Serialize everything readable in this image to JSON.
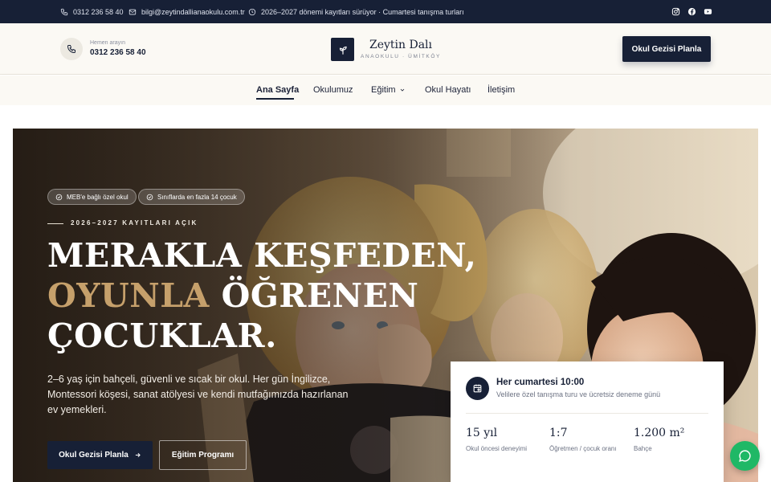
{
  "topbar": {
    "phone": "0312 236 58 40",
    "email": "bilgi@zeytindallianaokulu.com.tr",
    "notice": "2026–2027 dönemi kayıtları sürüyor · Cumartesi tanışma turları",
    "social": [
      "instagram-icon",
      "facebook-icon",
      "youtube-icon"
    ]
  },
  "header": {
    "phone_caption": "Hemen arayın",
    "phone_number": "0312 236 58 40",
    "logo_name": "Zeytin Dalı",
    "logo_subtitle": "ANAOKULU · ÜMİTKÖY",
    "cta": "Okul Gezisi Planla"
  },
  "nav": {
    "items": [
      {
        "label": "Ana Sayfa",
        "active": true
      },
      {
        "label": "Okulumuz",
        "active": false
      },
      {
        "label": "Eğitim",
        "active": false,
        "dropdown": true
      },
      {
        "label": "Okul Hayatı",
        "active": false
      },
      {
        "label": "İletişim",
        "active": false
      }
    ]
  },
  "hero": {
    "badges": [
      "MEB'e bağlı özel okul",
      "Sınıflarda en fazla 14 çocuk"
    ],
    "kicker": "2026–2027 KAYITLARI AÇIK",
    "title_line1": "MERAKLA KEŞFEDEN,",
    "title_accent": "OYUNLA",
    "title_line2_rest": " ÖĞRENEN",
    "title_line3": "ÇOCUKLAR.",
    "description": "2–6 yaş için bahçeli, güvenli ve sıcak bir okul. Her gün İngilizce, Montessori köşesi, sanat atölyesi ve kendi mutfağımızda hazırlanan ev yemekleri.",
    "primary_button": "Okul Gezisi Planla",
    "secondary_button": "Eğitim Programı"
  },
  "info_card": {
    "title": "Her cumartesi 10:00",
    "subtitle": "Velilere özel tanışma turu ve ücretsiz deneme günü",
    "stats": [
      {
        "value": "15 yıl",
        "label": "Okul öncesi deneyimi"
      },
      {
        "value": "1:7",
        "label": "Öğretmen / çocuk oranı"
      },
      {
        "value": "1.200 m²",
        "label": "Bahçe"
      }
    ]
  },
  "colors": {
    "navy": "#172036",
    "accent_gold": "#c6a06b",
    "header_bg": "#fbf9f4",
    "chat_green": "#1fb866"
  }
}
